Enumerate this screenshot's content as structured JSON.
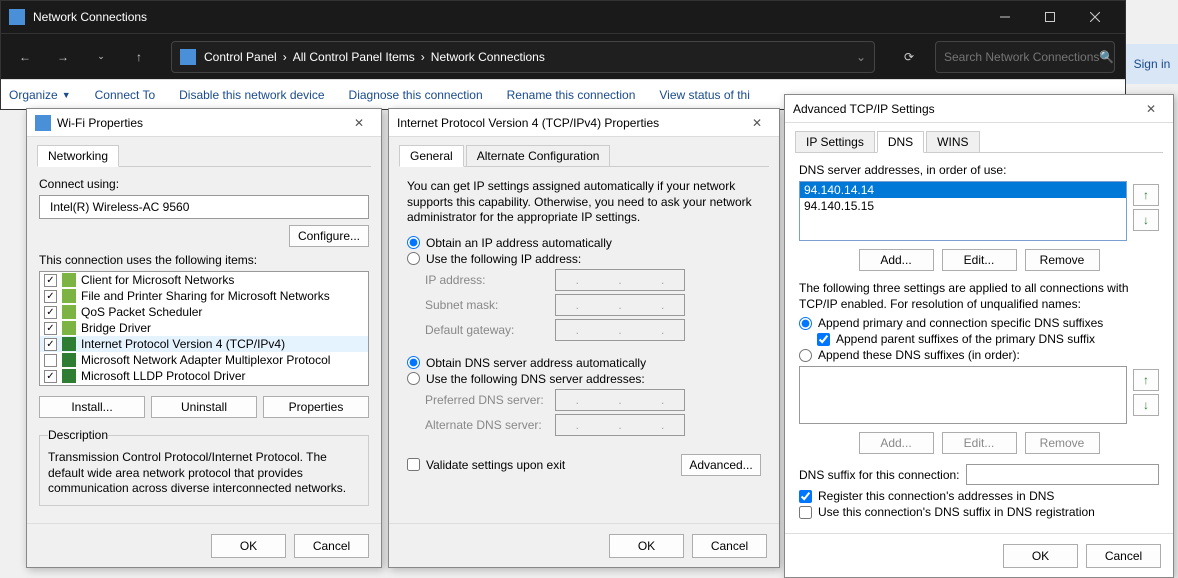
{
  "explorer": {
    "title": "Network Connections",
    "breadcrumb": [
      "Control Panel",
      "All Control Panel Items",
      "Network Connections"
    ],
    "search_placeholder": "Search Network Connections",
    "commands": {
      "organize": "Organize",
      "connect": "Connect To",
      "disable": "Disable this network device",
      "diagnose": "Diagnose this connection",
      "rename": "Rename this connection",
      "status": "View status of thi"
    }
  },
  "signin": "Sign in",
  "wifi": {
    "title": "Wi-Fi Properties",
    "tab": "Networking",
    "connect_using": "Connect using:",
    "adapter": "Intel(R) Wireless-AC 9560",
    "configure": "Configure...",
    "uses_label": "This connection uses the following items:",
    "items": [
      {
        "checked": true,
        "name": "Client for Microsoft Networks"
      },
      {
        "checked": true,
        "name": "File and Printer Sharing for Microsoft Networks"
      },
      {
        "checked": true,
        "name": "QoS Packet Scheduler"
      },
      {
        "checked": true,
        "name": "Bridge Driver"
      },
      {
        "checked": true,
        "name": "Internet Protocol Version 4 (TCP/IPv4)",
        "selected": true
      },
      {
        "checked": false,
        "name": "Microsoft Network Adapter Multiplexor Protocol"
      },
      {
        "checked": true,
        "name": "Microsoft LLDP Protocol Driver"
      }
    ],
    "install": "Install...",
    "uninstall": "Uninstall",
    "properties": "Properties",
    "desc_label": "Description",
    "desc": "Transmission Control Protocol/Internet Protocol. The default wide area network protocol that provides communication across diverse interconnected networks.",
    "ok": "OK",
    "cancel": "Cancel"
  },
  "ipv4": {
    "title": "Internet Protocol Version 4 (TCP/IPv4) Properties",
    "tabs": {
      "general": "General",
      "alt": "Alternate Configuration"
    },
    "intro": "You can get IP settings assigned automatically if your network supports this capability. Otherwise, you need to ask your network administrator for the appropriate IP settings.",
    "r_auto_ip": "Obtain an IP address automatically",
    "r_use_ip": "Use the following IP address:",
    "ip_address": "IP address:",
    "subnet": "Subnet mask:",
    "gateway": "Default gateway:",
    "r_auto_dns": "Obtain DNS server address automatically",
    "r_use_dns": "Use the following DNS server addresses:",
    "pref_dns": "Preferred DNS server:",
    "alt_dns": "Alternate DNS server:",
    "validate": "Validate settings upon exit",
    "advanced": "Advanced...",
    "ok": "OK",
    "cancel": "Cancel"
  },
  "adv": {
    "title": "Advanced TCP/IP Settings",
    "tabs": {
      "ip": "IP Settings",
      "dns": "DNS",
      "wins": "WINS"
    },
    "dns_label": "DNS server addresses, in order of use:",
    "dns_servers": [
      "94.140.14.14",
      "94.140.15.15"
    ],
    "add": "Add...",
    "edit": "Edit...",
    "remove": "Remove",
    "suffix_intro": "The following three settings are applied to all connections with TCP/IP enabled. For resolution of unqualified names:",
    "r_append_primary": "Append primary and connection specific DNS suffixes",
    "c_append_parent": "Append parent suffixes of the primary DNS suffix",
    "r_append_these": "Append these DNS suffixes (in order):",
    "suffix_label": "DNS suffix for this connection:",
    "c_register": "Register this connection's addresses in DNS",
    "c_use_suffix": "Use this connection's DNS suffix in DNS registration",
    "ok": "OK",
    "cancel": "Cancel"
  }
}
